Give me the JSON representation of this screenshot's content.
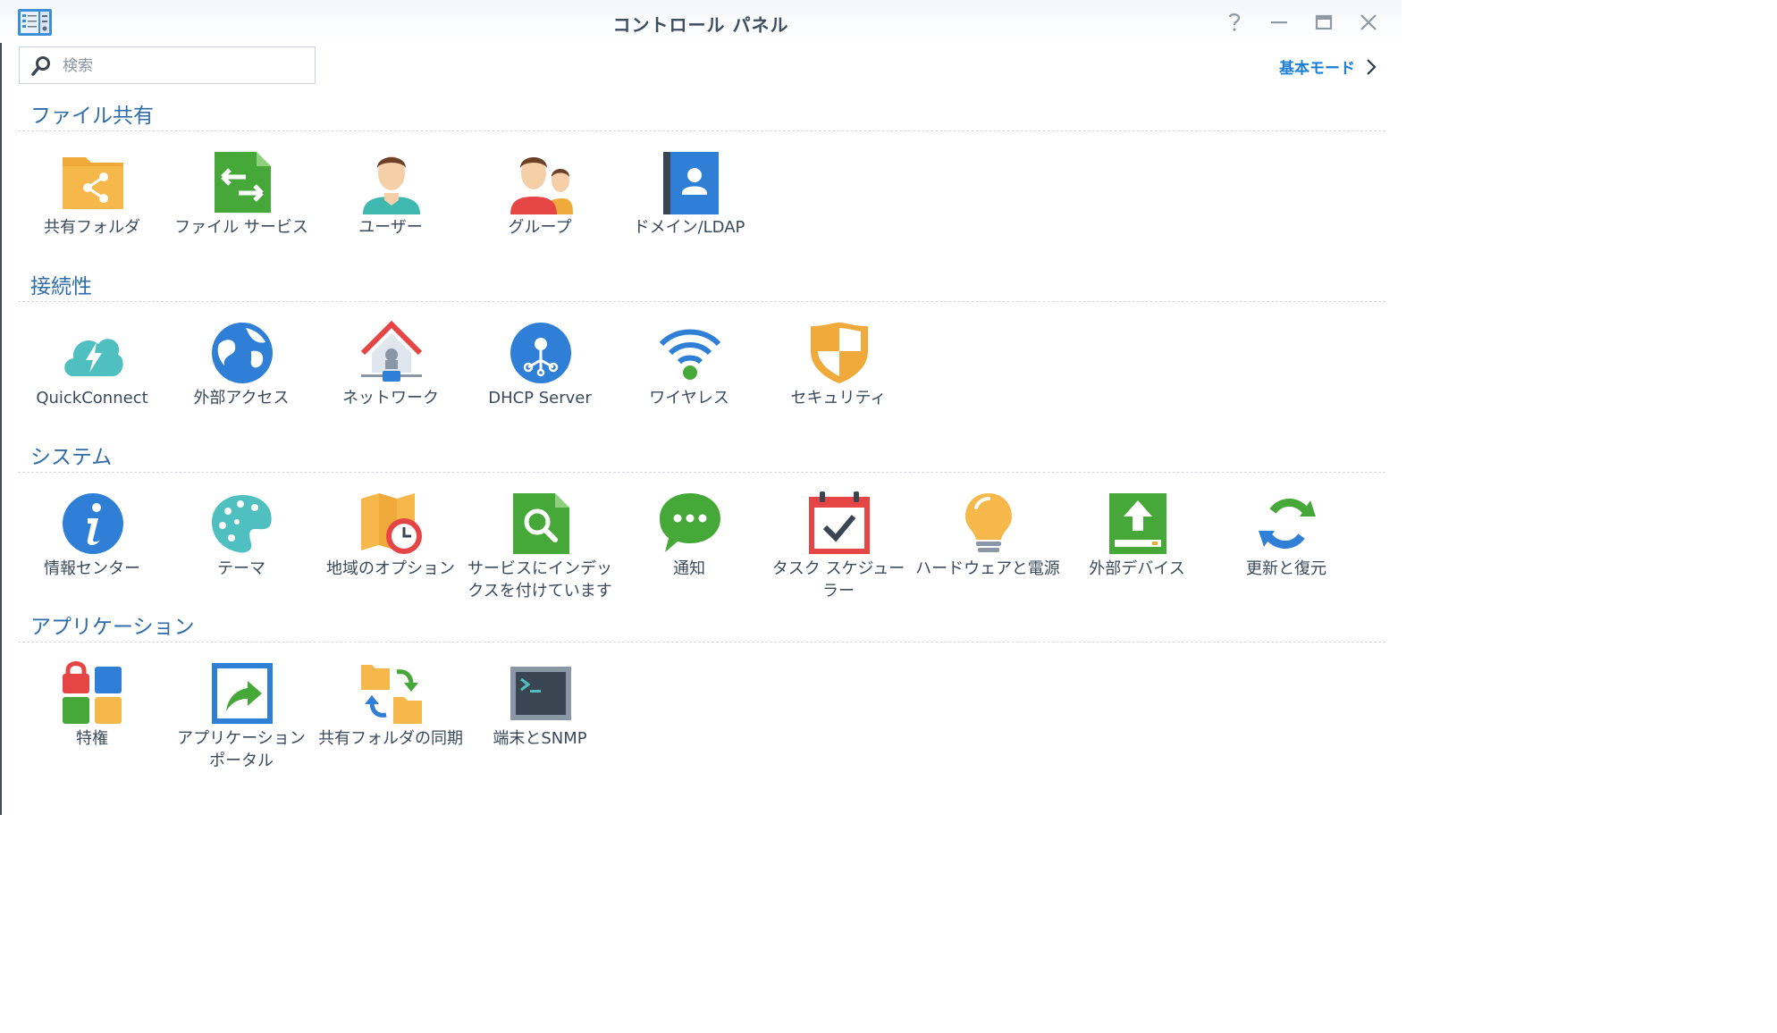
{
  "window": {
    "title": "コントロール パネル"
  },
  "search": {
    "placeholder": "検索",
    "value": ""
  },
  "mode_link": {
    "label": "基本モード"
  },
  "sections": [
    {
      "title": "ファイル共有",
      "items": [
        {
          "label": "共有フォルダ",
          "icon": "shared-folder-icon"
        },
        {
          "label": "ファイル サービス",
          "icon": "file-services-icon"
        },
        {
          "label": "ユーザー",
          "icon": "user-icon"
        },
        {
          "label": "グループ",
          "icon": "group-icon"
        },
        {
          "label": "ドメイン/LDAP",
          "icon": "domain-ldap-icon"
        }
      ]
    },
    {
      "title": "接続性",
      "items": [
        {
          "label": "QuickConnect",
          "icon": "quickconnect-icon"
        },
        {
          "label": "外部アクセス",
          "icon": "external-access-icon"
        },
        {
          "label": "ネットワーク",
          "icon": "network-icon"
        },
        {
          "label": "DHCP Server",
          "icon": "dhcp-server-icon"
        },
        {
          "label": "ワイヤレス",
          "icon": "wireless-icon"
        },
        {
          "label": "セキュリティ",
          "icon": "security-icon"
        }
      ]
    },
    {
      "title": "システム",
      "items": [
        {
          "label": "情報センター",
          "icon": "info-center-icon"
        },
        {
          "label": "テーマ",
          "icon": "theme-icon"
        },
        {
          "label": "地域のオプション",
          "icon": "regional-options-icon"
        },
        {
          "label": "サービスにインデックスを付けています",
          "icon": "indexing-service-icon"
        },
        {
          "label": "通知",
          "icon": "notification-icon"
        },
        {
          "label": "タスク スケジューラー",
          "icon": "task-scheduler-icon"
        },
        {
          "label": "ハードウェアと電源",
          "icon": "hardware-power-icon"
        },
        {
          "label": "外部デバイス",
          "icon": "external-devices-icon"
        },
        {
          "label": "更新と復元",
          "icon": "update-restore-icon"
        }
      ]
    },
    {
      "title": "アプリケーション",
      "items": [
        {
          "label": "特権",
          "icon": "privileges-icon"
        },
        {
          "label": "アプリケーション ポータル",
          "icon": "application-portal-icon"
        },
        {
          "label": "共有フォルダの同期",
          "icon": "shared-folder-sync-icon"
        },
        {
          "label": "端末とSNMP",
          "icon": "terminal-snmp-icon"
        }
      ]
    }
  ],
  "colors": {
    "accent": "#1a7ed6",
    "section_title": "#2f6da8"
  }
}
